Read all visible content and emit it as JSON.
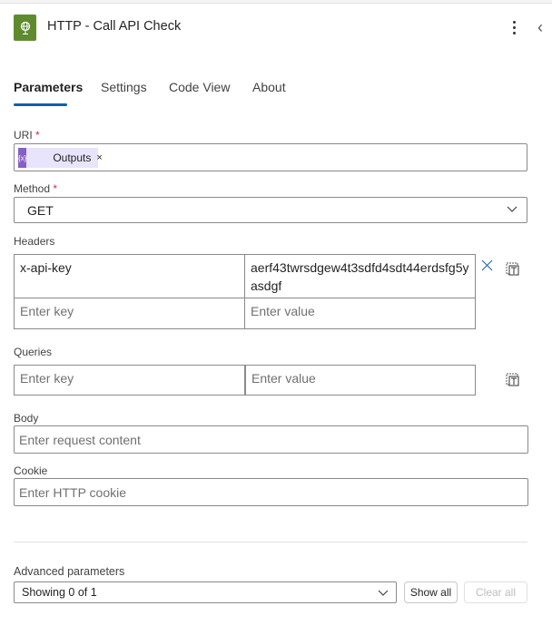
{
  "header": {
    "title": "HTTP - Call API Check",
    "icon": "globe-icon",
    "icon_color": "#5f8b2f"
  },
  "tabs": [
    {
      "label": "Parameters",
      "active": true
    },
    {
      "label": "Settings"
    },
    {
      "label": "Code View"
    },
    {
      "label": "About"
    }
  ],
  "uri": {
    "label": "URI",
    "required_mark": "*",
    "token": {
      "label": "Outputs",
      "icon": "{x}",
      "remove": "×"
    }
  },
  "method": {
    "label": "Method",
    "required_mark": "*",
    "value": "GET"
  },
  "headers": {
    "label": "Headers",
    "rows": [
      {
        "key": "x-api-key",
        "value": "aerf43twrsdgew4t3sdfd4sdt44erdsfg5yasdgf"
      }
    ],
    "key_placeholder": "Enter key",
    "value_placeholder": "Enter value"
  },
  "queries": {
    "label": "Queries",
    "key_placeholder": "Enter key",
    "value_placeholder": "Enter value"
  },
  "body": {
    "label": "Body",
    "placeholder": "Enter request content"
  },
  "cookie": {
    "label": "Cookie",
    "placeholder": "Enter HTTP cookie"
  },
  "advanced": {
    "label": "Advanced parameters",
    "value": "Showing 0 of 1",
    "show_all": "Show all",
    "clear_all": "Clear all"
  }
}
